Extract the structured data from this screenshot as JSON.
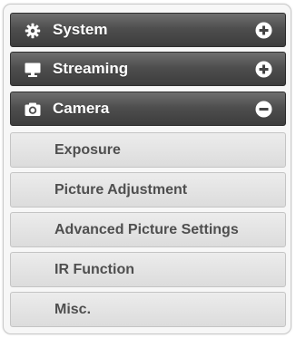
{
  "menu": {
    "sections": [
      {
        "label": "System",
        "icon": "gear-icon",
        "toggle": "plus-circle-icon",
        "expanded": false
      },
      {
        "label": "Streaming",
        "icon": "monitor-icon",
        "toggle": "plus-circle-icon",
        "expanded": false
      },
      {
        "label": "Camera",
        "icon": "camera-icon",
        "toggle": "minus-circle-icon",
        "expanded": true
      }
    ],
    "camera_items": [
      {
        "label": "Exposure"
      },
      {
        "label": "Picture Adjustment"
      },
      {
        "label": "Advanced Picture Settings"
      },
      {
        "label": "IR Function"
      },
      {
        "label": "Misc."
      }
    ]
  },
  "colors": {
    "header_bg": "#4e4e4e",
    "header_text": "#ffffff",
    "subitem_bg": "#e2e2e2",
    "subitem_text": "#4f4f4f"
  }
}
